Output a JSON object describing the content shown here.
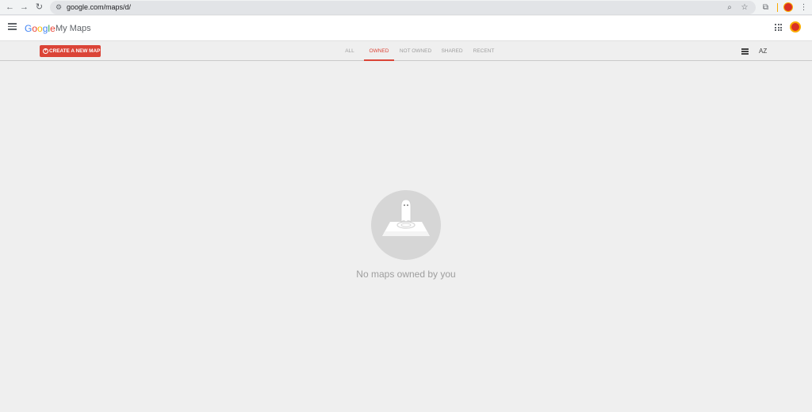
{
  "browser": {
    "url": "google.com/maps/d/",
    "back_icon": "←",
    "forward_icon": "→",
    "reload_icon": "↻",
    "site_info_icon": "⚙",
    "zoom_icon": "⌕",
    "star_icon": "☆",
    "extensions_icon": "⧉",
    "menu_icon": "⋮"
  },
  "header": {
    "logo_letters": [
      "G",
      "o",
      "o",
      "g",
      "l",
      "e"
    ],
    "product": "My Maps"
  },
  "toolbar": {
    "create_label": "CREATE A NEW MAP",
    "create_icon": "+",
    "tabs": [
      {
        "label": "ALL"
      },
      {
        "label": "OWNED"
      },
      {
        "label": "NOT OWNED"
      },
      {
        "label": "SHARED"
      },
      {
        "label": "RECENT"
      }
    ],
    "active_tab": "OWNED",
    "sort_label": "AZ"
  },
  "empty_state": {
    "message": "No maps owned by you"
  },
  "colors": {
    "accent": "#db4437",
    "background": "#efefef",
    "muted_text": "#9e9e9e"
  }
}
